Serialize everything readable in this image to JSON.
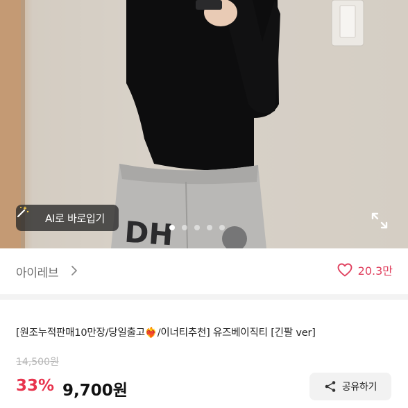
{
  "product_image": {
    "ai_button_label": "AI로 바로입기",
    "slide_count": 5,
    "active_slide": 1
  },
  "shop": {
    "name": "아이레브",
    "like_count": "20.3만"
  },
  "product": {
    "title": "[원조누적판매10만장/당일출고❤️‍🔥/이너티추천] 유즈베이직티 [긴팔 ver]",
    "original_price": "14,500원",
    "discount": "33%",
    "price": "9,700원"
  },
  "share": {
    "label": "공유하기"
  },
  "colors": {
    "accent": "#e8344e",
    "like": "#e0405e"
  }
}
